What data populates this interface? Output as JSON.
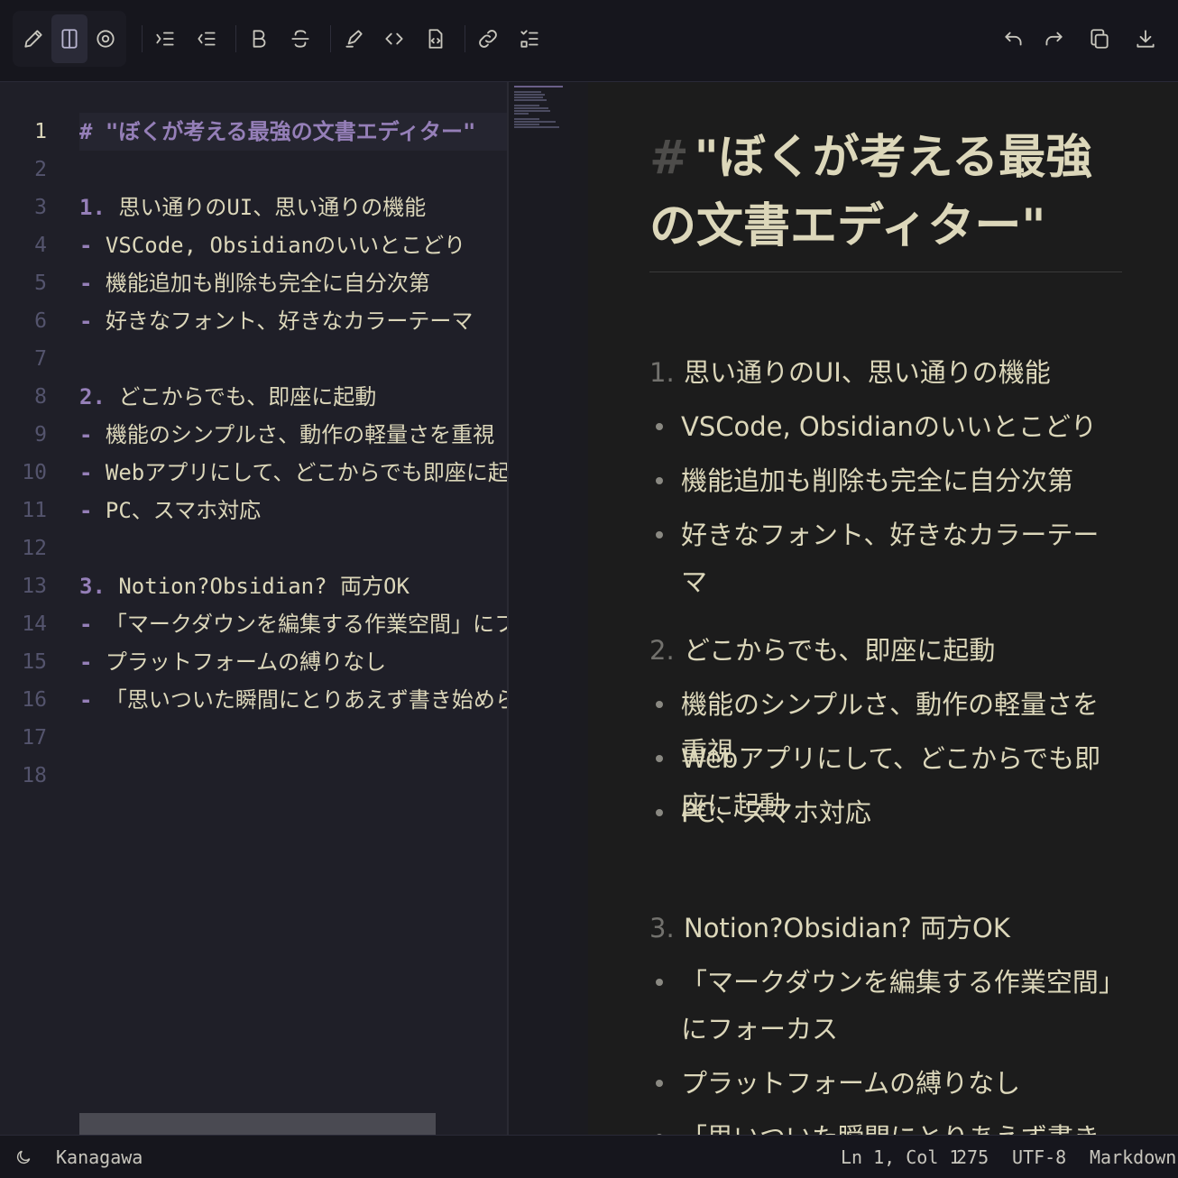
{
  "toolbar": {
    "buttons": [
      {
        "icon": "pencil-icon",
        "label": "Edit"
      },
      {
        "icon": "split-view-icon",
        "label": "Split view",
        "active": true
      },
      {
        "icon": "eye-icon",
        "label": "Preview"
      },
      {
        "icon": "indent-icon",
        "label": "Indent"
      },
      {
        "icon": "outdent-icon",
        "label": "Outdent"
      },
      {
        "icon": "bold-icon",
        "label": "Bold"
      },
      {
        "icon": "strikethrough-icon",
        "label": "Strikethrough"
      },
      {
        "icon": "highlighter-icon",
        "label": "Highlight"
      },
      {
        "icon": "code-icon",
        "label": "Code"
      },
      {
        "icon": "code-block-icon",
        "label": "Code block"
      },
      {
        "icon": "link-icon",
        "label": "Link"
      },
      {
        "icon": "checklist-icon",
        "label": "Task list"
      },
      {
        "icon": "undo-icon",
        "label": "Undo"
      },
      {
        "icon": "redo-icon",
        "label": "Redo"
      },
      {
        "icon": "copy-icon",
        "label": "Copy"
      },
      {
        "icon": "download-icon",
        "label": "Download"
      }
    ]
  },
  "editor": {
    "line_numbers": [
      "1",
      "2",
      "3",
      "4",
      "5",
      "6",
      "7",
      "8",
      "9",
      "10",
      "11",
      "12",
      "13",
      "14",
      "15",
      "16",
      "17",
      "18"
    ],
    "lines": [
      {
        "marker": "#",
        "text": " \"ぼくが考える最強の文書エディター\""
      },
      {
        "marker": "",
        "text": ""
      },
      {
        "marker": "1.",
        "text": " 思い通りのUI、思い通りの機能"
      },
      {
        "marker": "-",
        "text": " VSCode, Obsidianのいいとこどり"
      },
      {
        "marker": "-",
        "text": " 機能追加も削除も完全に自分次第"
      },
      {
        "marker": "-",
        "text": " 好きなフォント、好きなカラーテーマ"
      },
      {
        "marker": "",
        "text": ""
      },
      {
        "marker": "2.",
        "text": " どこからでも、即座に起動"
      },
      {
        "marker": "-",
        "text": " 機能のシンプルさ、動作の軽量さを重視"
      },
      {
        "marker": "-",
        "text": " Webアプリにして、どこからでも即座に起動"
      },
      {
        "marker": "-",
        "text": " PC、スマホ対応"
      },
      {
        "marker": "",
        "text": ""
      },
      {
        "marker": "3.",
        "text": " Notion?Obsidian? 両方OK"
      },
      {
        "marker": "-",
        "text": " 「マークダウンを編集する作業空間」にフォーカス"
      },
      {
        "marker": "-",
        "text": " プラットフォームの縛りなし"
      },
      {
        "marker": "-",
        "text": " 「思いついた瞬間にとりあえず書き始められる」を"
      },
      {
        "marker": "",
        "text": ""
      },
      {
        "marker": "",
        "text": ""
      }
    ]
  },
  "preview": {
    "heading_hash": "#",
    "heading": "\"ぼくが考える最強の文書エディター\"",
    "sections": [
      {
        "num": "1.",
        "title": "思い通りのUI、思い通りの機能",
        "bullets": [
          "VSCode, Obsidianのいいとこどり",
          "機能追加も削除も完全に自分次第",
          "好きなフォント、好きなカラーテーマ"
        ]
      },
      {
        "num": "2.",
        "title": "どこからでも、即座に起動",
        "bullets": [
          "機能のシンプルさ、動作の軽量さを重視",
          "Webアプリにして、どこからでも即座に起動",
          "PC、スマホ対応"
        ]
      },
      {
        "num": "3.",
        "title": "Notion?Obsidian? 両方OK",
        "bullets": [
          "「マークダウンを編集する作業空間」にフォーカス",
          "プラットフォームの縛りなし",
          "「思いついた瞬間にとりあえず書き始められ"
        ]
      }
    ]
  },
  "status": {
    "theme": "Kanagawa",
    "cursor": "Ln 1, Col 1",
    "count": "275",
    "encoding": "UTF-8",
    "language": "Markdown"
  }
}
